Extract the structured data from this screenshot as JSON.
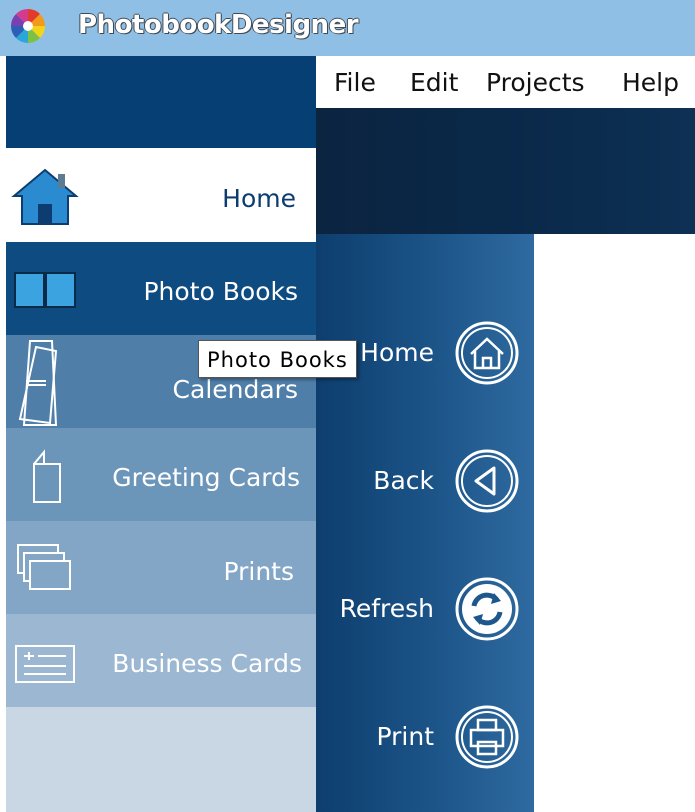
{
  "app": {
    "title": "PhotobookDesigner"
  },
  "menubar": {
    "items": [
      "File",
      "Edit",
      "Projects",
      "Help"
    ]
  },
  "sidebar": {
    "items": [
      {
        "label": "Home",
        "icon": "house-icon"
      },
      {
        "label": "Photo Books",
        "icon": "photo-book-icon"
      },
      {
        "label": "Calendars",
        "icon": "calendar-icon"
      },
      {
        "label": "Greeting Cards",
        "icon": "greeting-card-icon"
      },
      {
        "label": "Prints",
        "icon": "prints-icon"
      },
      {
        "label": "Business Cards",
        "icon": "business-card-icon"
      }
    ]
  },
  "actions": {
    "items": [
      {
        "label": "Home",
        "icon": "home-circle-icon"
      },
      {
        "label": "Back",
        "icon": "back-circle-icon"
      },
      {
        "label": "Refresh",
        "icon": "refresh-circle-icon"
      },
      {
        "label": "Print",
        "icon": "print-circle-icon"
      }
    ]
  },
  "tooltip": {
    "text": "Photo Books"
  },
  "colors": {
    "titlebar": "#8fbfe4",
    "sidebar_dark": "#063f73",
    "action_panel": "#1e578b"
  }
}
